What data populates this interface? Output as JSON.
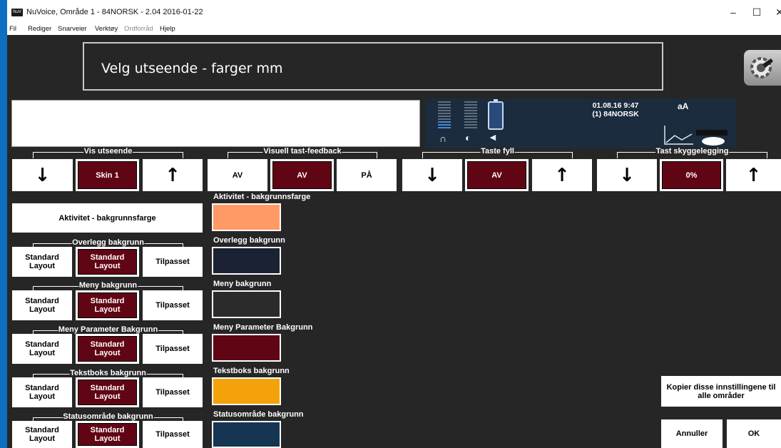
{
  "window": {
    "title": "NuVoice, Område 1 - 84NORSK - 2.04 2016-01-22",
    "app_icon_text": "NuV",
    "controls": [
      "–",
      "☐",
      "✕"
    ]
  },
  "menubar": {
    "items": [
      {
        "label": "Fil",
        "enabled": true
      },
      {
        "label": "Rediger",
        "enabled": true
      },
      {
        "label": "Snarveier",
        "enabled": true
      },
      {
        "label": "Verktøy",
        "enabled": true
      },
      {
        "label": "Ordforråd",
        "enabled": false
      },
      {
        "label": "Hjelp",
        "enabled": true
      }
    ]
  },
  "header": {
    "title": "Velg utseende - farger mm"
  },
  "status": {
    "date_time": "01.08.16 9:47",
    "profile": "(1) 84NORSK",
    "font_icon_text": "aA"
  },
  "top_groups": [
    {
      "label": "Vis utseende",
      "down": "↓",
      "value": "Skin 1",
      "up": "↑"
    },
    {
      "label": "Visuell tast-feedback",
      "options": [
        "AV",
        "AV",
        "PÅ"
      ]
    },
    {
      "label": "Taste fyll",
      "down": "↓",
      "value": "AV",
      "up": "↑"
    },
    {
      "label": "Tast skyggelegging",
      "down": "↓",
      "value": "0%",
      "up": "↑"
    }
  ],
  "activity_button": "Aktivitet - bakgrunnsfarge",
  "rows": [
    {
      "label": "Overlegg bakgrunn",
      "opt1": "Standard Layout",
      "opt2": "Standard Layout",
      "opt3": "Tilpasset"
    },
    {
      "label": "Meny bakgrunn",
      "opt1": "Standard Layout",
      "opt2": "Standard Layout",
      "opt3": "Tilpasset"
    },
    {
      "label": "Meny Parameter Bakgrunn",
      "opt1": "Standard Layout",
      "opt2": "Standard Layout",
      "opt3": "Tilpasset"
    },
    {
      "label": "Tekstboks bakgrunn",
      "opt1": "Standard Layout",
      "opt2": "Standard Layout",
      "opt3": "Tilpasset"
    },
    {
      "label": "Statusområde bakgrunn",
      "opt1": "Standard Layout",
      "opt2": "Standard Layout",
      "opt3": "Tilpasset"
    }
  ],
  "swatches": [
    {
      "label": "Aktivitet - bakgrunnsfarge",
      "color": "#ff9966"
    },
    {
      "label": "Overlegg bakgrunn",
      "color": "#1a2233"
    },
    {
      "label": "Meny bakgrunn",
      "color": "#2b2b2b"
    },
    {
      "label": "Meny Parameter Bakgrunn",
      "color": "#600514"
    },
    {
      "label": "Tekstboks bakgrunn",
      "color": "#f4a20c"
    },
    {
      "label": "Statusområde bakgrunn",
      "color": "#163553"
    }
  ],
  "actions": {
    "copy": "Kopier disse innstillingene til alle områder",
    "cancel": "Annuller",
    "ok": "OK"
  },
  "colors": {
    "selected": "#600514",
    "background": "#262626",
    "status_panel": "#1b2c3e",
    "window_accent": "#0d6fc0"
  }
}
